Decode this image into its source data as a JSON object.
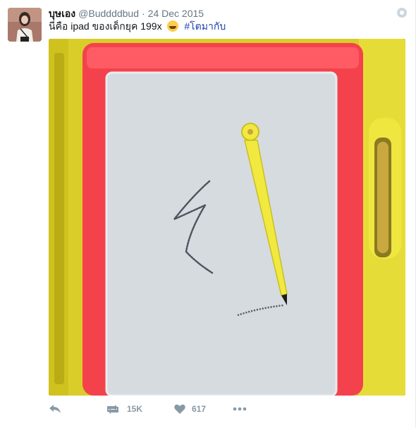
{
  "tweet": {
    "author_name": "บุษเอง",
    "author_handle": "@Buddddbud",
    "separator": "·",
    "date": "24 Dec 2015",
    "text": "นี่คือ ipad ของเด็กยุค 199x",
    "emoji": "face-with-tears-of-joy-icon",
    "hashtag": "#โตมากับ",
    "hashtag_color": "#1b3fa8"
  },
  "media": {
    "subject": "magnetic drawing board with yellow stylus",
    "colors": {
      "frame_red": "#f4424d",
      "frame_yellow": "#d9cd2a",
      "screen_gray": "#d6dbe0",
      "stylus_yellow": "#f1e93f"
    }
  },
  "actions": {
    "reply_icon": "reply-icon",
    "retweet_icon": "retweet-icon",
    "retweet_count": "15K",
    "like_icon": "heart-icon",
    "like_count": "617",
    "more_icon": "more-dots-icon"
  }
}
